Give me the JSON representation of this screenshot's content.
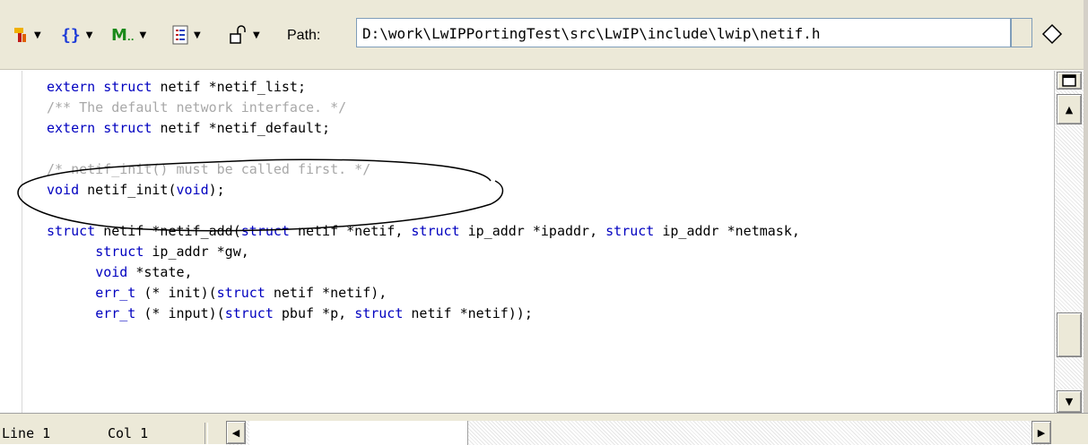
{
  "toolbar": {
    "items": [
      {
        "icon": "hammer-icon",
        "color": "#e8a000"
      },
      {
        "icon": "braces-icon",
        "color": "#1e3cd8"
      },
      {
        "icon": "bookmark-m-icon",
        "color": "#1a8a1a"
      },
      {
        "icon": "document-list-icon",
        "color": "#c02020"
      },
      {
        "icon": "unlock-icon",
        "color": "#000000"
      }
    ],
    "path_label": "Path:",
    "path_value": "D:\\work\\LwIPPortingTest\\src\\LwIP\\include\\lwip\\netif.h",
    "diamond_icon": "diamond-icon"
  },
  "editor": {
    "lines": [
      [
        [
          "kw",
          "extern "
        ],
        [
          "kw",
          "struct "
        ],
        [
          "",
          "netif *netif_list;"
        ]
      ],
      [
        [
          "cm",
          "/** The default network interface. */"
        ]
      ],
      [
        [
          "kw",
          "extern "
        ],
        [
          "kw",
          "struct "
        ],
        [
          "",
          "netif *netif_default;"
        ]
      ],
      [],
      [
        [
          "cm",
          "/* netif_init() must be called first. */"
        ]
      ],
      [
        [
          "kw",
          "void "
        ],
        [
          "",
          "netif_init("
        ],
        [
          "kw",
          "void"
        ],
        [
          "",
          ");"
        ]
      ],
      [],
      [
        [
          "kw",
          "struct "
        ],
        [
          "",
          "netif *netif_add("
        ],
        [
          "kw",
          "struct "
        ],
        [
          "",
          "netif *netif, "
        ],
        [
          "kw",
          "struct "
        ],
        [
          "",
          "ip_addr *ipaddr, "
        ],
        [
          "kw",
          "struct "
        ],
        [
          "",
          "ip_addr *netmask,"
        ]
      ],
      [
        [
          "",
          "      "
        ],
        [
          "kw",
          "struct "
        ],
        [
          "",
          "ip_addr *gw,"
        ]
      ],
      [
        [
          "",
          "      "
        ],
        [
          "kw",
          "void "
        ],
        [
          "",
          "*state,"
        ]
      ],
      [
        [
          "",
          "      "
        ],
        [
          "kw",
          "err_t "
        ],
        [
          "",
          "(* init)("
        ],
        [
          "kw",
          "struct "
        ],
        [
          "",
          "netif *netif),"
        ]
      ],
      [
        [
          "",
          "      "
        ],
        [
          "kw",
          "err_t "
        ],
        [
          "",
          "(* input)("
        ],
        [
          "kw",
          "struct "
        ],
        [
          "",
          "pbuf *p, "
        ],
        [
          "kw",
          "struct "
        ],
        [
          "",
          "netif *netif));"
        ]
      ]
    ]
  },
  "status": {
    "line": "Line 1",
    "col": "Col 1"
  }
}
